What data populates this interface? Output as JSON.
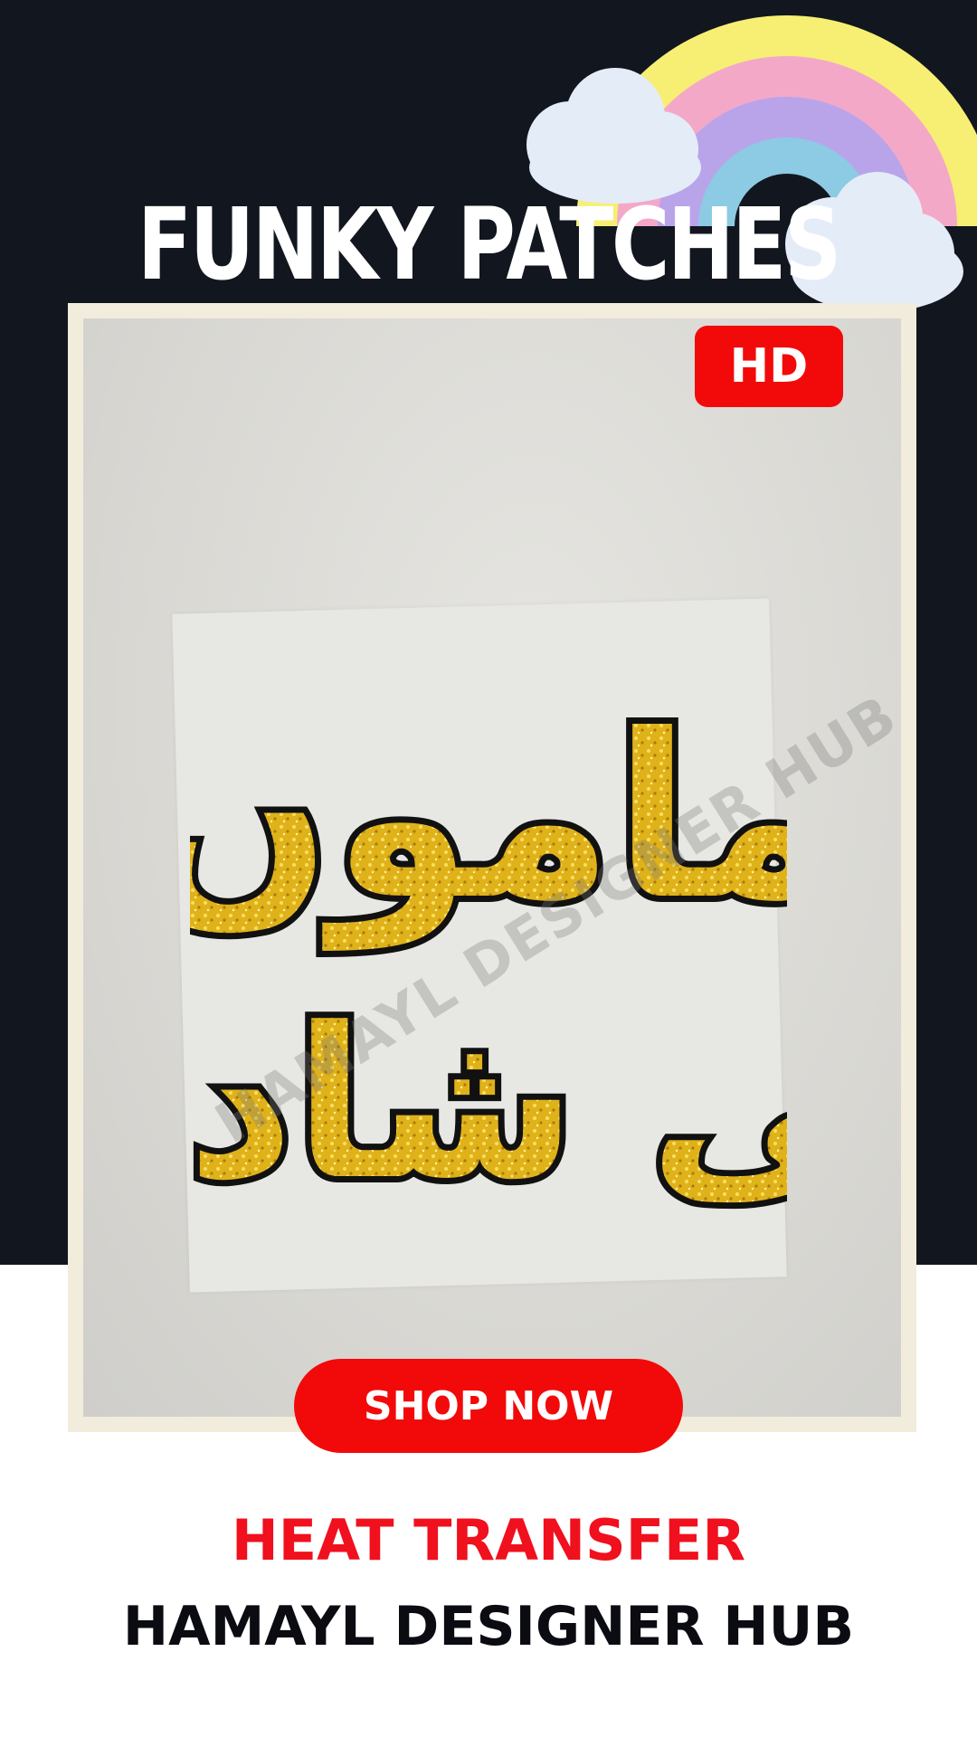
{
  "headline": "FUNKY PATCHES",
  "badge": "HD",
  "product_image": {
    "calligraphy_text": "ماموں کی شادی",
    "watermark": "HAMAYL DESIGNER HUB"
  },
  "cta": {
    "label": "SHOP NOW"
  },
  "subtitle": "HEAT TRANSFER",
  "brand": "HAMAYL DESIGNER HUB",
  "colors": {
    "background_dark": "#12161f",
    "accent_red": "#f20a0a",
    "frame": "#f1ecdc",
    "glitter_gold": "#e0b21a"
  },
  "icons": [
    "rainbow-cloud-icon"
  ]
}
